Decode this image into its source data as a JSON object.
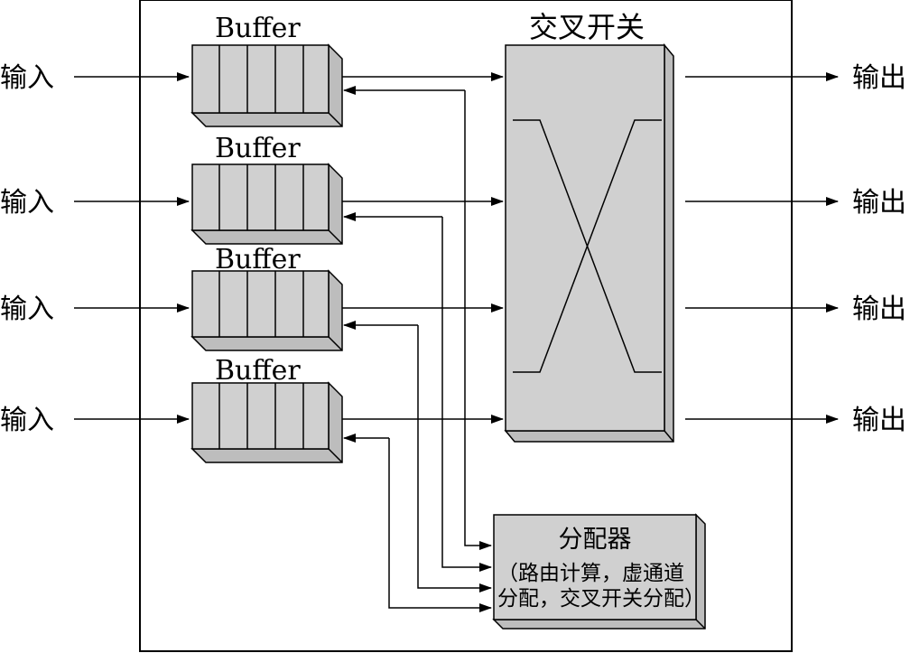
{
  "inputs": [
    "输入",
    "输入",
    "输入",
    "输入"
  ],
  "outputs": [
    "输出",
    "输出",
    "输出",
    "输出"
  ],
  "buffers": [
    "Buffer",
    "Buffer",
    "Buffer",
    "Buffer"
  ],
  "crossbar": {
    "label": "交叉开关"
  },
  "allocator": {
    "title": "分配器",
    "line1": "（路由计算，虚通道",
    "line2": "分配，交叉开关分配）"
  },
  "colors": {
    "box_fill": "#d0d0d0",
    "stroke": "#000000",
    "background": "#ffffff"
  }
}
